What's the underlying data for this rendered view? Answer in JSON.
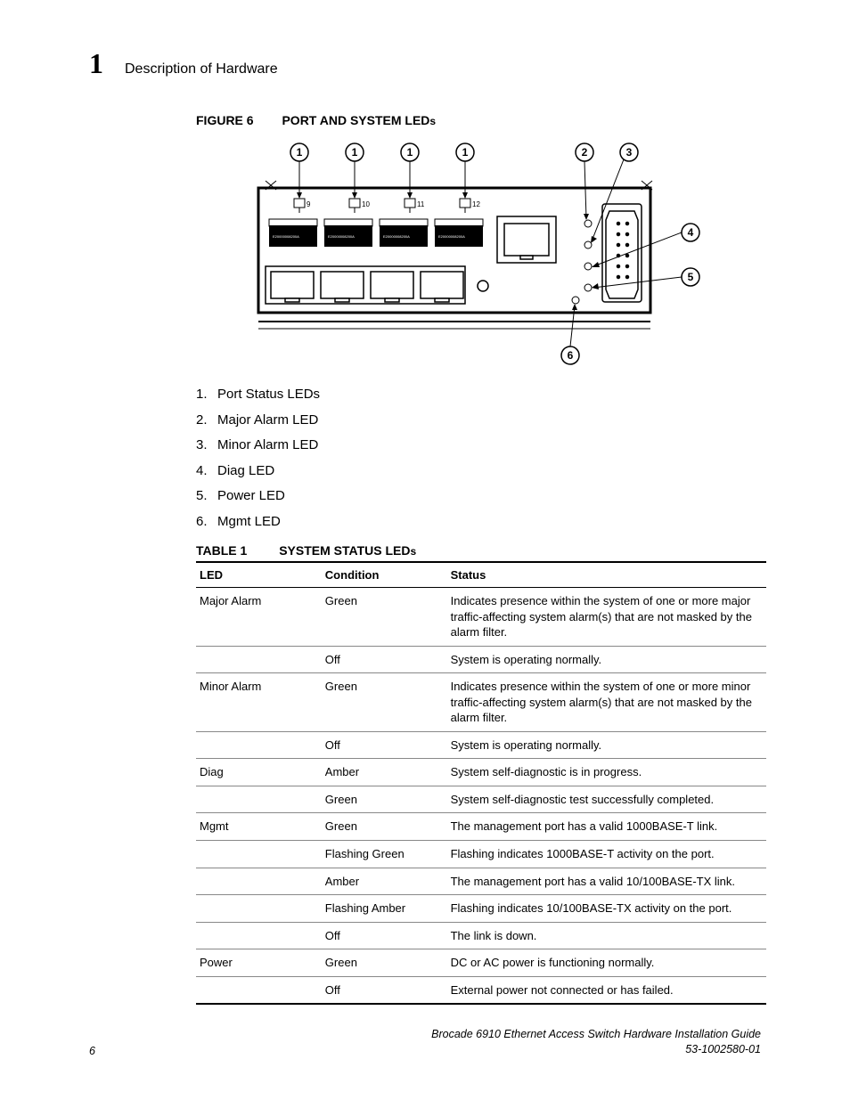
{
  "header": {
    "chapter": "1",
    "title": "Description of Hardware"
  },
  "figure": {
    "label": "FIGURE 6",
    "title_main": "PORT AND SYSTEM LED",
    "title_suffix": "s",
    "callouts": [
      "1",
      "1",
      "1",
      "1",
      "2",
      "3",
      "4",
      "5",
      "6"
    ],
    "port_numbers": [
      "9",
      "10",
      "11",
      "12"
    ],
    "sfp_label": "E20000008200A"
  },
  "legend": [
    {
      "num": "1.",
      "text": "Port Status LEDs"
    },
    {
      "num": "2.",
      "text": "Major Alarm LED"
    },
    {
      "num": "3.",
      "text": "Minor Alarm LED"
    },
    {
      "num": "4.",
      "text": "Diag LED"
    },
    {
      "num": "5.",
      "text": "Power LED"
    },
    {
      "num": "6.",
      "text": "Mgmt LED"
    }
  ],
  "table": {
    "label": "TABLE 1",
    "title_main": "SYSTEM STATUS LED",
    "title_suffix": "s",
    "headers": [
      "LED",
      "Condition",
      "Status"
    ],
    "rows": [
      {
        "led": "Major Alarm",
        "condition": "Green",
        "status": "Indicates presence within the system of one or more major traffic-affecting system alarm(s) that are not masked by the alarm filter."
      },
      {
        "led": "",
        "condition": "Off",
        "status": "System is operating normally."
      },
      {
        "led": "Minor Alarm",
        "condition": "Green",
        "status": "Indicates presence within the system of one or more minor traffic-affecting system alarm(s) that are not masked by the alarm filter."
      },
      {
        "led": "",
        "condition": "Off",
        "status": "System is operating normally."
      },
      {
        "led": "Diag",
        "condition": "Amber",
        "status": "System self-diagnostic is in progress."
      },
      {
        "led": "",
        "condition": "Green",
        "status": "System self-diagnostic test successfully completed."
      },
      {
        "led": "Mgmt",
        "condition": "Green",
        "status": "The management port has a valid 1000BASE-T link."
      },
      {
        "led": "",
        "condition": "Flashing Green",
        "status": "Flashing indicates 1000BASE-T activity on the port."
      },
      {
        "led": "",
        "condition": "Amber",
        "status": "The management port has a valid 10/100BASE-TX link."
      },
      {
        "led": "",
        "condition": "Flashing Amber",
        "status": "Flashing indicates 10/100BASE-TX activity on the port."
      },
      {
        "led": "",
        "condition": "Off",
        "status": "The link is down."
      },
      {
        "led": "Power",
        "condition": "Green",
        "status": "DC or AC power is functioning normally."
      },
      {
        "led": "",
        "condition": "Off",
        "status": "External power not connected or has failed."
      }
    ]
  },
  "footer": {
    "page": "6",
    "doc_title": "Brocade 6910 Ethernet Access Switch Hardware Installation Guide",
    "doc_num": "53-1002580-01"
  }
}
